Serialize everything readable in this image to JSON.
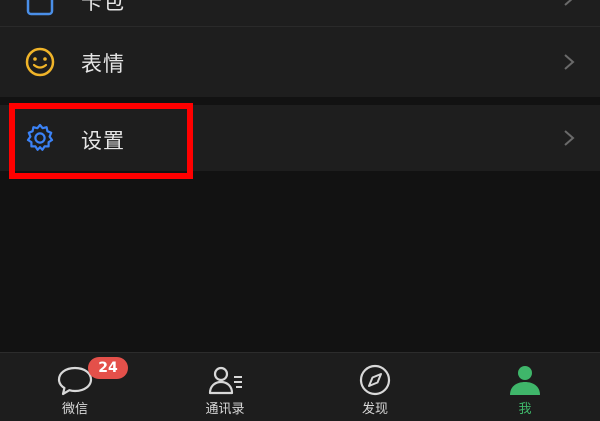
{
  "menu": {
    "items": [
      {
        "id": "wallet",
        "label": "卡包",
        "icon": "card-wallet-icon"
      },
      {
        "id": "stickers",
        "label": "表情",
        "icon": "smiley-icon"
      },
      {
        "id": "settings",
        "label": "设置",
        "icon": "gear-icon"
      }
    ]
  },
  "tabbar": {
    "tabs": [
      {
        "id": "chats",
        "label": "微信",
        "icon": "chat-bubble-icon",
        "badge": "24"
      },
      {
        "id": "contacts",
        "label": "通讯录",
        "icon": "contacts-icon"
      },
      {
        "id": "discover",
        "label": "发现",
        "icon": "compass-icon"
      },
      {
        "id": "me",
        "label": "我",
        "icon": "person-icon",
        "active": true
      }
    ]
  },
  "colors": {
    "background": "#121212",
    "row": "#1e1e1e",
    "active_tab": "#3fb66a",
    "badge": "#e4504a",
    "highlight": "#ff0000",
    "gear_icon": "#3b82f6",
    "smiley_icon": "#f0b429"
  }
}
